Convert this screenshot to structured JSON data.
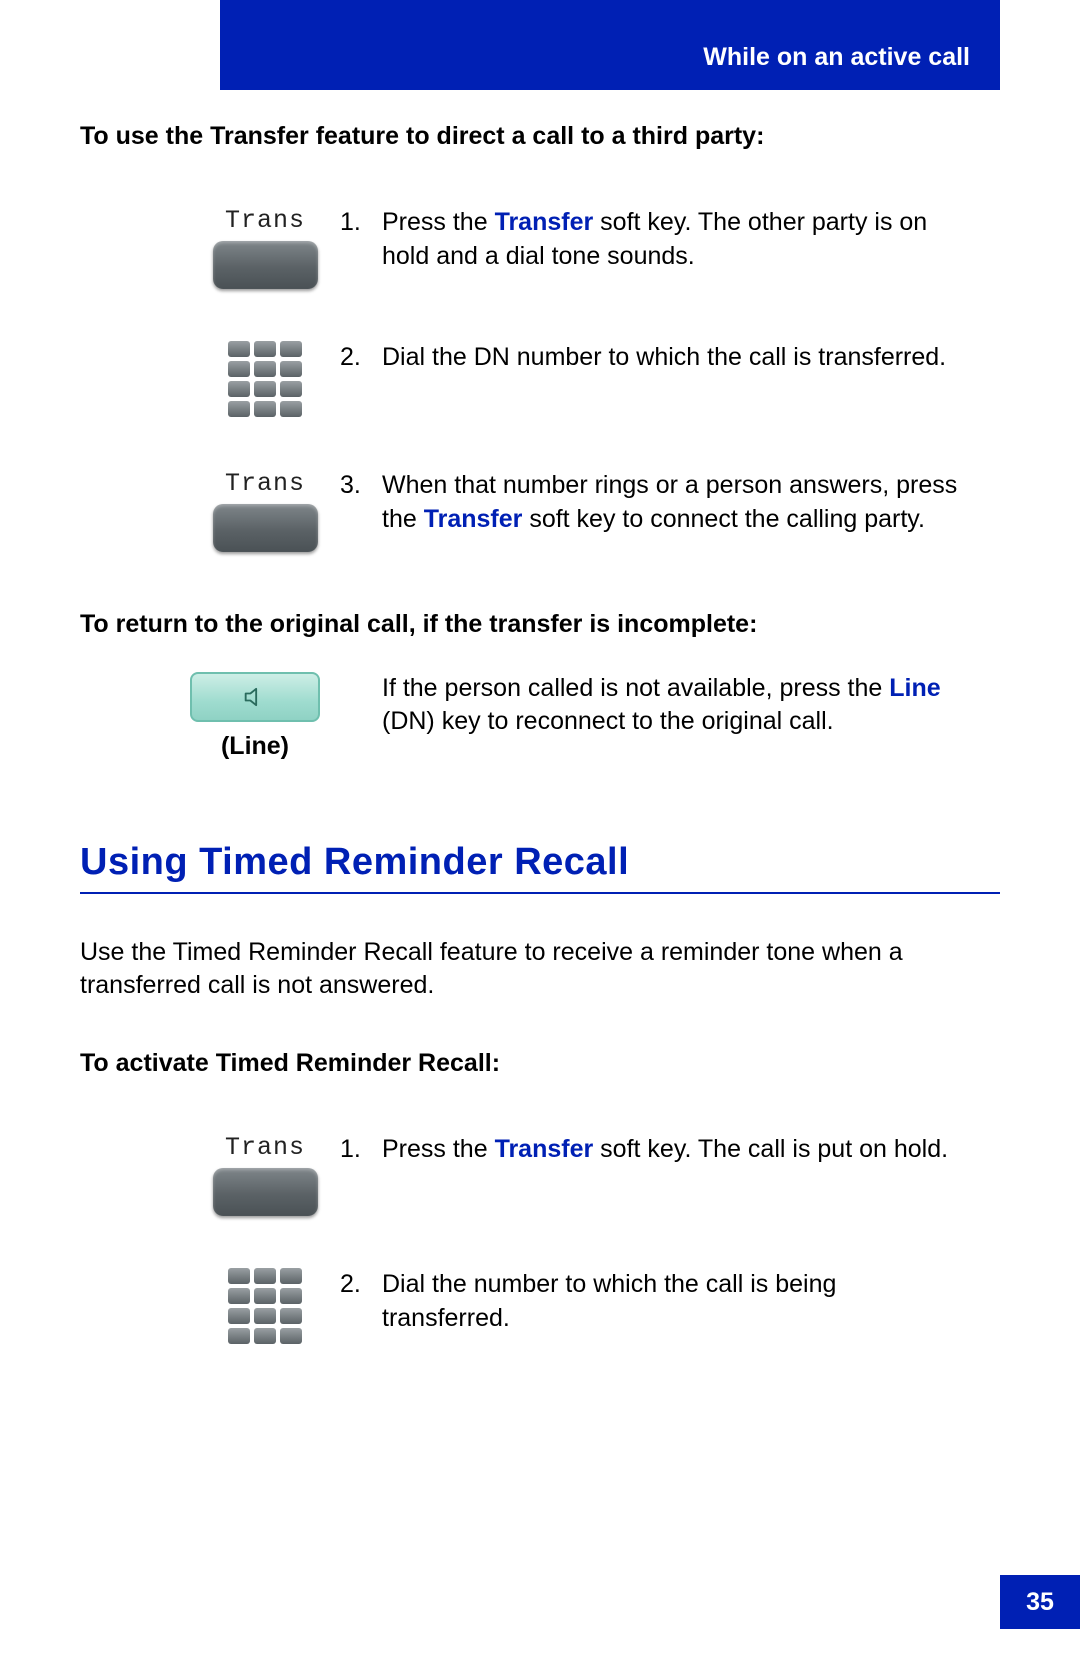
{
  "header": {
    "title": "While on an active call"
  },
  "intro1": "To use the Transfer feature to direct a call to a third party:",
  "softkey_labels": {
    "trans": "Trans"
  },
  "steps_a": [
    {
      "num": "1.",
      "pre": "Press the ",
      "kw": "Transfer",
      "post": " soft key. The other party is on hold and a dial tone sounds."
    },
    {
      "num": "2.",
      "pre": "Dial the DN number to which the call is transferred.",
      "kw": "",
      "post": ""
    },
    {
      "num": "3.",
      "pre": "When that number rings or a person answers, press the ",
      "kw": "Transfer",
      "post": " soft key to connect the calling party."
    }
  ],
  "intro2": "To return to the original call, if the transfer is incomplete:",
  "line": {
    "caption": "(Line)",
    "text_pre": "If the person called is not available, press the ",
    "kw": "Line",
    "text_post": " (DN) key to reconnect to the original call."
  },
  "section2_title": "Using Timed Reminder Recall",
  "section2_intro": "Use the Timed Reminder Recall feature to receive a reminder tone when a transferred call is not answered.",
  "intro3": "To activate Timed Reminder Recall:",
  "steps_b": [
    {
      "num": "1.",
      "pre": "Press the ",
      "kw": "Transfer",
      "post": " soft key. The call is put on hold."
    },
    {
      "num": "2.",
      "pre": "Dial the number to which the call is being transferred.",
      "kw": "",
      "post": ""
    }
  ],
  "page_number": "35"
}
